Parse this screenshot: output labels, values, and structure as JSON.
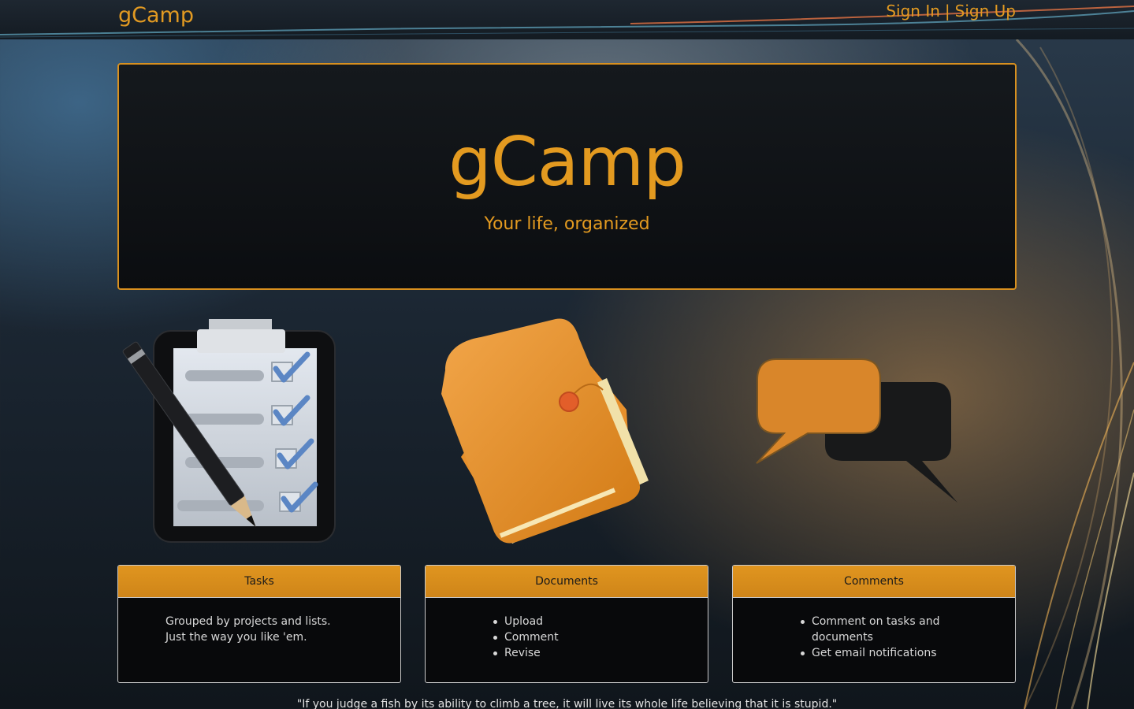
{
  "header": {
    "brand": "gCamp",
    "sign_in": "Sign In",
    "separator": "|",
    "sign_up": "Sign Up"
  },
  "hero": {
    "title": "gCamp",
    "subtitle": "Your life, organized"
  },
  "features": [
    {
      "title": "Tasks",
      "icon": "clipboard-checklist-icon",
      "text": "Grouped by projects and lists. Just the way you like 'em."
    },
    {
      "title": "Documents",
      "icon": "folder-icon",
      "items": [
        "Upload",
        "Comment",
        "Revise"
      ]
    },
    {
      "title": "Comments",
      "icon": "speech-bubbles-icon",
      "items": [
        "Comment on tasks and documents",
        "Get email notifications"
      ]
    }
  ],
  "quote": "\"If you judge a fish by its ability to climb a tree, it will live its whole life believing that it is stupid.\"",
  "colors": {
    "accent": "#e29a22",
    "card_bg": "#08090b",
    "card_border": "#c9c9c9"
  }
}
